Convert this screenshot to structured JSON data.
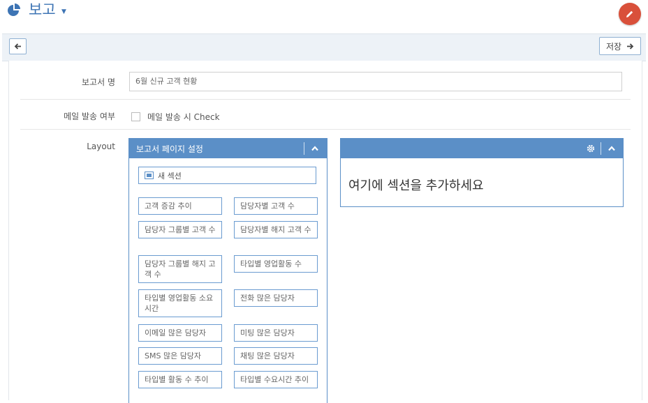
{
  "header": {
    "title": "보고",
    "icon": "pie-chart-icon",
    "edit_icon": "pencil-icon"
  },
  "toolbar": {
    "save_label": "저장"
  },
  "form": {
    "name_label": "보고서 명",
    "name_value": "6월 신규 고객 현황",
    "mail_label": "메일 발송 여부",
    "mail_checkbox_label": "메일 발송 시 Check",
    "mail_checked": false,
    "layout_label": "Layout"
  },
  "page_settings_panel": {
    "title": "보고서 페이지 설정",
    "new_section_label": "새 섹션",
    "items": [
      "고객 증감 추이",
      "담당자별 고객 수",
      "담당자 그룹별 고객 수",
      "담당자별 해지 고객 수",
      "담당자 그룹별 해지 고객 수",
      "타입별 영업활동 수",
      "타입별 영업활동 소요시간",
      "전화 많은 담당자",
      "이메일 많은 담당자",
      "미팅 많은 담당자",
      "SMS 많은 담당자",
      "채팅 많은 담당자",
      "타입별 활동 수 추이",
      "타입별 수요시간 추이"
    ]
  },
  "section_panel": {
    "hint": "여기에 섹션을 추가하세요"
  },
  "colors": {
    "accent": "#5b8fc7",
    "title_blue": "#3d74b4",
    "fab_red": "#d9503a"
  }
}
